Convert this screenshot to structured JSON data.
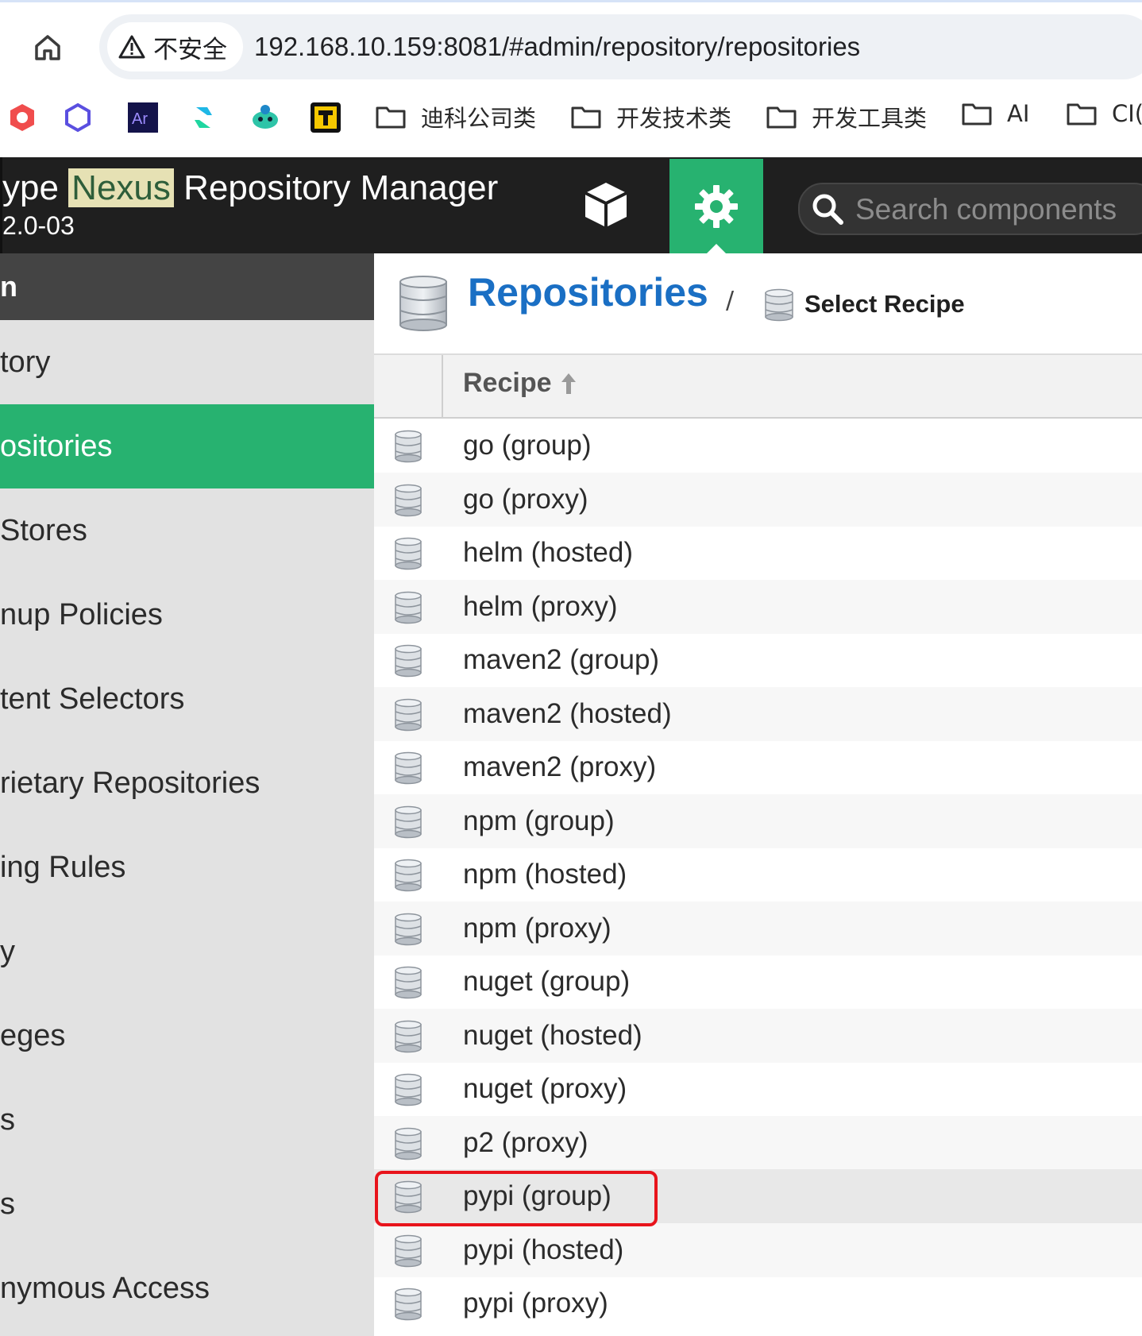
{
  "browser": {
    "security_label": "不安全",
    "url": "192.168.10.159:8081/#admin/repository/repositories",
    "bookmark_folders": [
      "迪科公司类",
      "开发技术类",
      "开发工具类",
      "AI",
      "CI("
    ]
  },
  "header": {
    "brand_prefix": "ype ",
    "brand_highlight": "Nexus",
    "brand_suffix": " Repository Manager",
    "version": "2.0-03",
    "search_placeholder": "Search components"
  },
  "sidebar": {
    "section": "n",
    "items": [
      "tory",
      "ositories",
      " Stores",
      "nup Policies",
      "tent Selectors",
      "rietary Repositories",
      "ing Rules",
      "y",
      "eges",
      "s",
      "s",
      "nymous Access"
    ],
    "active_index": 1
  },
  "main": {
    "title": "Repositories",
    "breadcrumb_sep": "/",
    "breadcrumb": "Select Recipe",
    "column_header": "Recipe",
    "recipes": [
      "go (group)",
      "go (proxy)",
      "helm (hosted)",
      "helm (proxy)",
      "maven2 (group)",
      "maven2 (hosted)",
      "maven2 (proxy)",
      "npm (group)",
      "npm (hosted)",
      "npm (proxy)",
      "nuget (group)",
      "nuget (hosted)",
      "nuget (proxy)",
      "p2 (proxy)",
      "pypi (group)",
      "pypi (hosted)",
      "pypi (proxy)"
    ],
    "highlighted_recipe": "pypi (group)"
  },
  "colors": {
    "accent_green": "#27b270",
    "title_blue": "#1a6fc4",
    "highlight_red": "#e8141c",
    "header_dark": "#1f1f1f"
  }
}
